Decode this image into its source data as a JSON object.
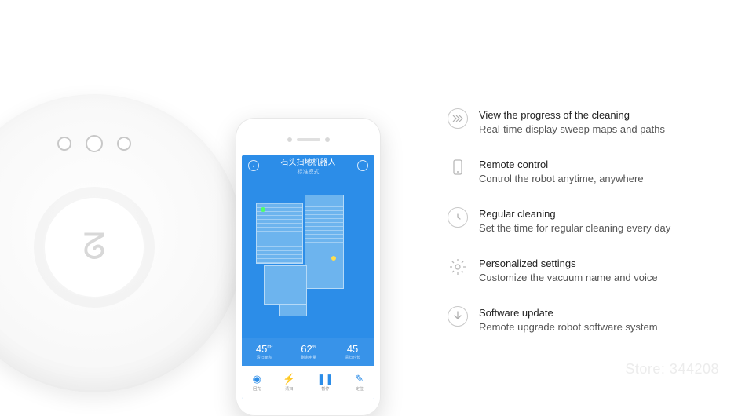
{
  "phone": {
    "app_title": "石头扫地机器人",
    "app_subtitle": "标准模式",
    "stats": [
      {
        "value": "45",
        "unit": "m²",
        "label": "清扫面积"
      },
      {
        "value": "62",
        "unit": "%",
        "label": "剩余电量"
      },
      {
        "value": "45",
        "unit": "",
        "label": "清扫时长"
      }
    ],
    "bottom_icons": [
      {
        "glyph": "◉",
        "label": "回充"
      },
      {
        "glyph": "⚡",
        "label": "清扫"
      },
      {
        "glyph": "❚❚",
        "label": "暂停"
      },
      {
        "glyph": "✎",
        "label": "定位"
      }
    ]
  },
  "robot": {
    "logo_glyph": "ᘔ"
  },
  "features": [
    {
      "icon": "progress",
      "title": "View the progress of the cleaning",
      "desc": "Real-time display sweep maps and paths"
    },
    {
      "icon": "remote",
      "title": "Remote control",
      "desc": "Control  the robot anytime, anywhere"
    },
    {
      "icon": "clock",
      "title": "Regular cleaning",
      "desc": "Set the time for regular cleaning every day"
    },
    {
      "icon": "gear",
      "title": "Personalized settings",
      "desc": "Customize the vacuum name and voice"
    },
    {
      "icon": "download",
      "title": "Software update",
      "desc": "Remote upgrade robot software system"
    }
  ],
  "watermark": "Store: 344208"
}
